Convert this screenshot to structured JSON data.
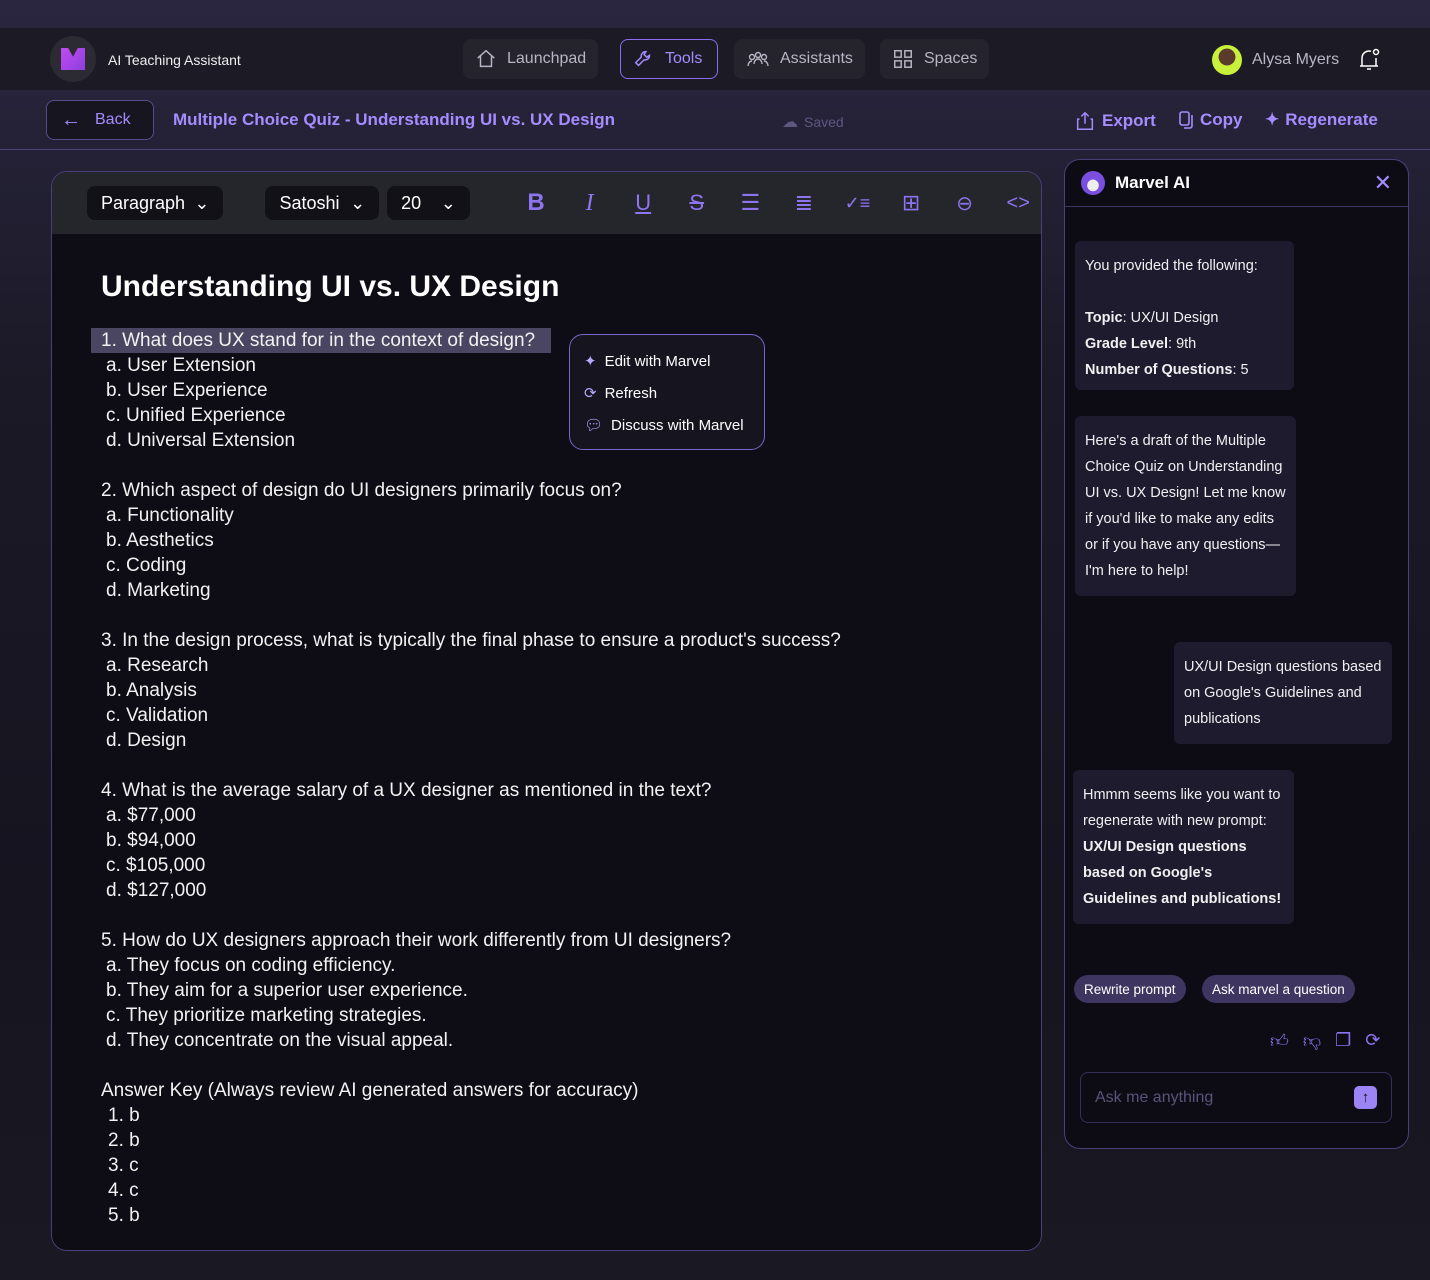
{
  "app": {
    "title": "AI Teaching Assistant"
  },
  "nav": [
    {
      "label": "Launchpad",
      "icon": "home-icon"
    },
    {
      "label": "Tools",
      "icon": "wrench-icon"
    },
    {
      "label": "Assistants",
      "icon": "users-icon"
    },
    {
      "label": "Spaces",
      "icon": "grid-icon"
    }
  ],
  "user": {
    "name": "Alysa Myers"
  },
  "subheader": {
    "back": "Back",
    "title": "Multiple Choice Quiz - Understanding UI vs. UX Design",
    "saved": "Saved",
    "export": "Export",
    "copy": "Copy",
    "regenerate": "Regenerate"
  },
  "toolbar": {
    "block": "Paragraph",
    "font": "Satoshi",
    "size": "20"
  },
  "doc": {
    "heading": "Understanding UI vs. UX Design",
    "questions": [
      {
        "q": "1. What does UX stand for in the context of design?",
        "opts": [
          "a. User Extension",
          "b. User Experience",
          "c. Unified Experience",
          "d. Universal Extension"
        ]
      },
      {
        "q": "2. Which aspect of design do UI designers primarily focus on?",
        "opts": [
          "a. Functionality",
          "b. Aesthetics",
          "c. Coding",
          "d. Marketing"
        ]
      },
      {
        "q": "3. In the design process, what is typically the final phase to ensure a product's success?",
        "opts": [
          "a. Research",
          "b. Analysis",
          "c. Validation",
          "d. Design"
        ]
      },
      {
        "q": "4. What is the average salary of a UX designer as mentioned in the text?",
        "opts": [
          "a.  $77,000",
          "b.  $94,000",
          "c.  $105,000",
          "d.  $127,000"
        ]
      },
      {
        "q": "5. How do UX designers approach their work differently from UI designers?",
        "opts": [
          "a. They focus on coding efficiency.",
          "b. They aim for a superior user experience.",
          "c. They prioritize marketing strategies.",
          "d. They concentrate on the visual appeal."
        ]
      }
    ],
    "answer_key": {
      "title": "Answer Key (Always review AI generated answers for accuracy)",
      "answers": [
        "1. b",
        "2. b",
        "3. c",
        "4. c",
        "5. b"
      ]
    }
  },
  "popup": {
    "edit": "Edit with Marvel",
    "refresh": "Refresh",
    "discuss": "Discuss with Marvel"
  },
  "chat": {
    "title": "Marvel AI",
    "m1": {
      "intro": "You provided the following:",
      "topic_k": "Topic",
      "topic_v": ": UX/UI Design",
      "grade_k": "Grade Level",
      "grade_v": ": 9th",
      "num_k": "Number of Questions",
      "num_v": ": 5"
    },
    "m2": "Here's a draft of the Multiple Choice Quiz on Understanding UI vs. UX Design! Let me know if you'd like to make any edits or if you have any questions—I'm here to help!",
    "m3": "UX/UI Design questions based on Google's Guidelines and publications",
    "m4_pre": "Hmmm seems like you want to regenerate with new prompt: ",
    "m4_bold": "UX/UI Design questions based on Google's Guidelines and publications!",
    "chips": [
      "Rewrite prompt",
      "Ask marvel a question"
    ],
    "placeholder": "Ask me anything"
  }
}
